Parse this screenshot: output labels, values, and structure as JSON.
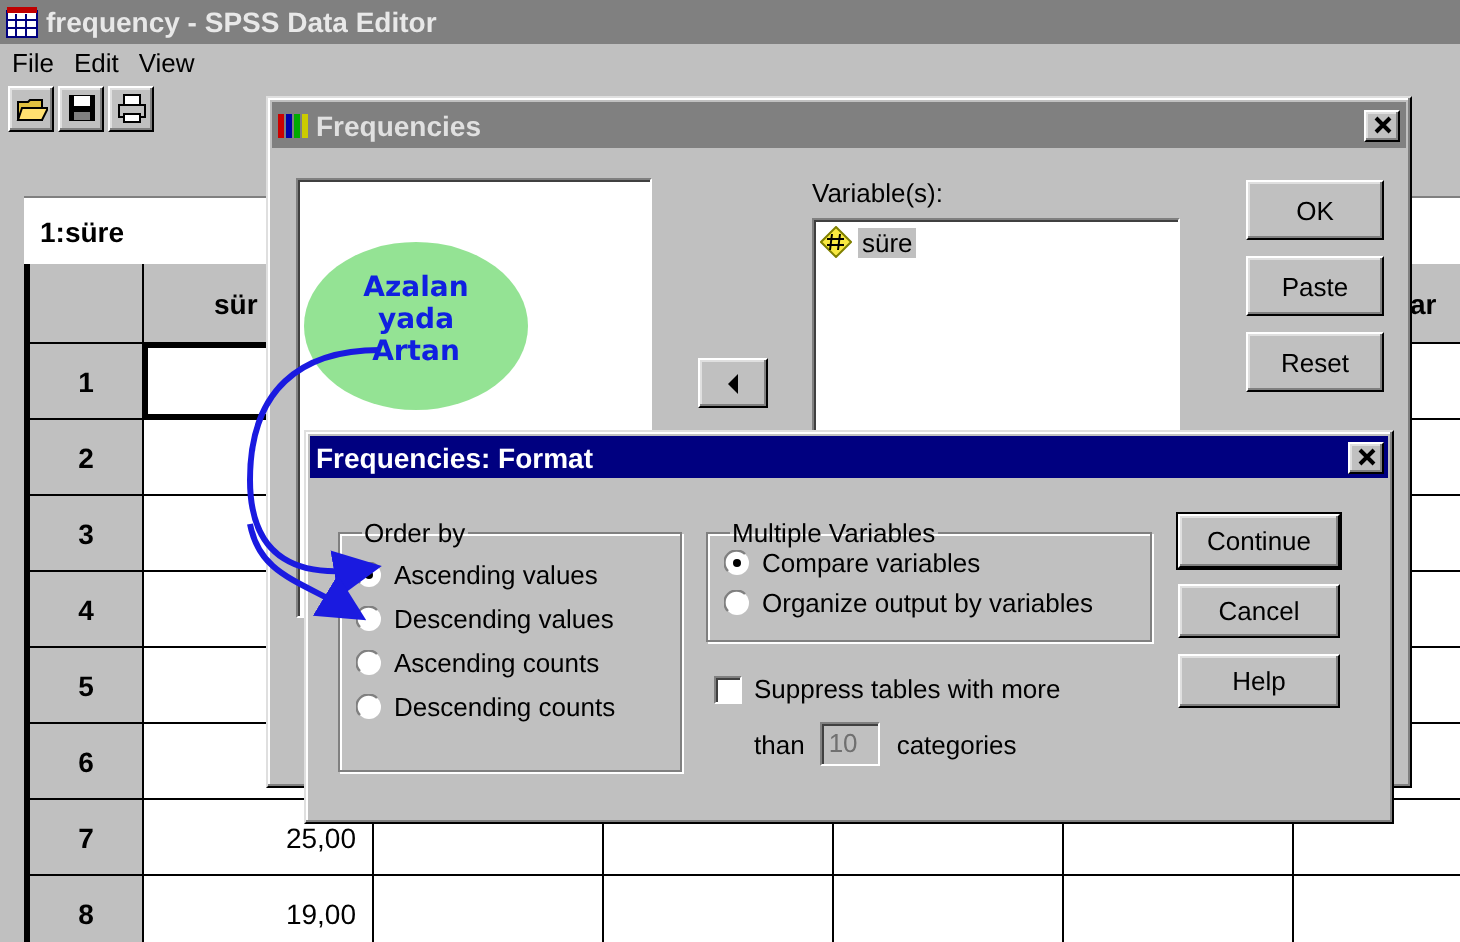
{
  "editor": {
    "title": "frequency - SPSS Data Editor",
    "menu": [
      "File",
      "Edit",
      "View"
    ],
    "cell_ref": "1:süre",
    "columns": [
      "sür",
      "ar"
    ],
    "rows": [
      {
        "label": "1",
        "selected": true
      },
      {
        "label": "2",
        "selected": false
      },
      {
        "label": "3",
        "selected": false
      },
      {
        "label": "4",
        "selected": false
      },
      {
        "label": "5",
        "selected": false
      },
      {
        "label": "6",
        "selected": false
      },
      {
        "label": "7",
        "selected": false,
        "value": "25,00"
      },
      {
        "label": "8",
        "selected": false,
        "value": "19,00"
      }
    ]
  },
  "frequencies": {
    "title": "Frequencies",
    "variables_label": "Variable(s):",
    "variables": [
      "süre"
    ],
    "buttons": [
      "OK",
      "Paste",
      "Reset"
    ]
  },
  "format": {
    "title": "Frequencies: Format",
    "order_by": {
      "label": "Order by",
      "options": [
        {
          "label": "Ascending values",
          "selected": true
        },
        {
          "label": "Descending values",
          "selected": false
        },
        {
          "label": "Ascending counts",
          "selected": false
        },
        {
          "label": "Descending counts",
          "selected": false
        }
      ]
    },
    "multiple_variables": {
      "label": "Multiple Variables",
      "options": [
        {
          "label": "Compare variables",
          "selected": true
        },
        {
          "label": "Organize output by variables",
          "selected": false
        }
      ]
    },
    "suppress": {
      "label": "Suppress tables with more",
      "checked": false
    },
    "than_label": "than",
    "max_categories": {
      "value": "10",
      "disabled": true
    },
    "categories_label": "categories",
    "buttons": [
      "Continue",
      "Cancel",
      "Help"
    ]
  },
  "annotation": {
    "text": "Azalan yada Artan"
  }
}
